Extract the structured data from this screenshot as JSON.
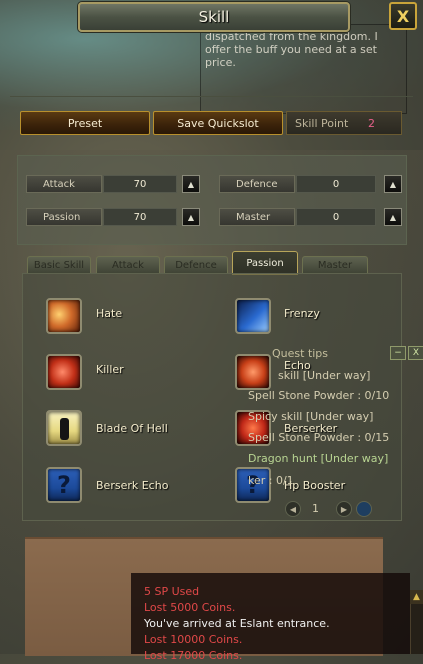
{
  "window": {
    "title": "Skill"
  },
  "npc_dialog": {
    "text": "dispatched from the kingdom. I offer the buff you need at a set price."
  },
  "toolbar": {
    "preset_label": "Preset",
    "save_quickslot_label": "Save Quickslot",
    "skill_point_label": "Skill Point",
    "skill_point_value": "2"
  },
  "stats": [
    {
      "label": "Attack",
      "value": "70"
    },
    {
      "label": "Defence",
      "value": "0"
    },
    {
      "label": "Passion",
      "value": "70"
    },
    {
      "label": "Master",
      "value": "0"
    }
  ],
  "tabs": [
    "Basic Skill",
    "Attack",
    "Defence",
    "Passion",
    "Master"
  ],
  "active_tab": "Passion",
  "skills": [
    {
      "name": "Hate",
      "icon": "hate-skill-icon",
      "color": "#d06a2a"
    },
    {
      "name": "Frenzy",
      "icon": "frenzy-skill-icon",
      "color": "#2a6ad0"
    },
    {
      "name": "Killer",
      "icon": "killer-skill-icon",
      "color": "#c23018"
    },
    {
      "name": "Echo",
      "icon": "echo-skill-icon",
      "color": "#c84018"
    },
    {
      "name": "Blade Of Hell",
      "icon": "blade-of-hell-skill-icon",
      "color": "#e6d880"
    },
    {
      "name": "Berserker",
      "icon": "berserker-skill-icon",
      "color": "#c02818"
    },
    {
      "name": "Berserk Echo",
      "icon": "question-mark-icon",
      "color": "#1c4a9a"
    },
    {
      "name": "Hp Booster",
      "icon": "question-mark-icon",
      "color": "#1c4a9a"
    }
  ],
  "quest_tips": {
    "title": "Quest tips",
    "lines": [
      {
        "text": "skill  [Under way]",
        "kind": "title"
      },
      {
        "text": "Spell Stone Powder : 0/10",
        "kind": "item"
      },
      {
        "text": "Spicy skill  [Under way]",
        "kind": "title"
      },
      {
        "text": "Spell Stone Powder : 0/15",
        "kind": "item"
      },
      {
        "text": "Dragon hunt  [Under way]",
        "kind": "step"
      },
      {
        "text": "ker : 0/1",
        "kind": "item"
      }
    ],
    "page": "1"
  },
  "chat_log": [
    {
      "text": "5 SP Used",
      "color": "#e04848"
    },
    {
      "text": "Lost 5000 Coins.",
      "color": "#e04848"
    },
    {
      "text": "You've arrived at Eslant entrance.",
      "color": "#f0f0f0"
    },
    {
      "text": "Lost 10000 Coins.",
      "color": "#e04848"
    },
    {
      "text": "Lost 17000 Coins.",
      "color": "#e04848"
    }
  ]
}
